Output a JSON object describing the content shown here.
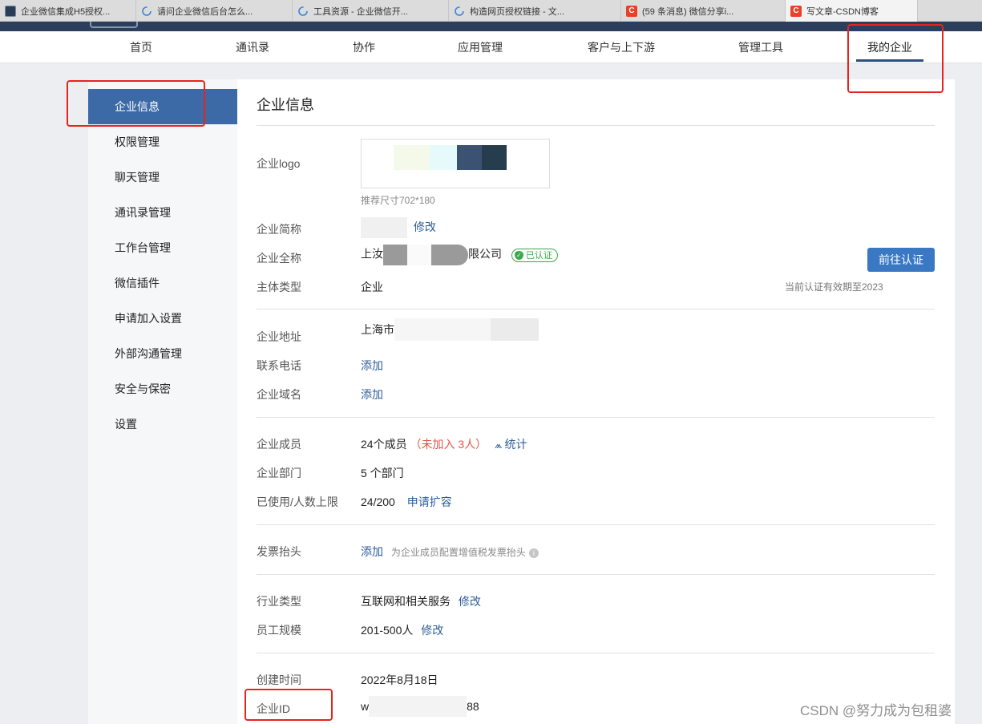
{
  "browser_tabs": [
    {
      "title": "企业微信集成H5授权..."
    },
    {
      "title": "请问企业微信后台怎么..."
    },
    {
      "title": "工具资源 - 企业微信开..."
    },
    {
      "title": "构造网页授权链接 - 文..."
    },
    {
      "title": "(59 条消息) 微信分享i..."
    },
    {
      "title": "写文章-CSDN博客"
    }
  ],
  "topnav": {
    "items": [
      "首页",
      "通讯录",
      "协作",
      "应用管理",
      "客户与上下游",
      "管理工具",
      "我的企业"
    ],
    "active": "我的企业"
  },
  "sidebar": {
    "items": [
      "企业信息",
      "权限管理",
      "聊天管理",
      "通讯录管理",
      "工作台管理",
      "微信插件",
      "申请加入设置",
      "外部沟通管理",
      "安全与保密",
      "设置"
    ],
    "active": "企业信息"
  },
  "main": {
    "title": "企业信息",
    "logo": {
      "label": "企业logo",
      "hint": "推荐尺寸702*180"
    },
    "short_name": {
      "label": "企业简称",
      "action": "修改"
    },
    "full_name": {
      "label": "企业全称",
      "value_start": "上汝",
      "value_end": "限公司",
      "badge": "已认证"
    },
    "entity_type": {
      "label": "主体类型",
      "value": "企业"
    },
    "verify_button": "前往认证",
    "validity_text": "当前认证有效期至2023",
    "address": {
      "label": "企业地址",
      "value": "上海市"
    },
    "phone": {
      "label": "联系电话",
      "action": "添加"
    },
    "domain": {
      "label": "企业域名",
      "action": "添加"
    },
    "members": {
      "label": "企业成员",
      "value": "24个成员",
      "pending": "（未加入 3人）",
      "stats": "统计"
    },
    "departments": {
      "label": "企业部门",
      "value": "5 个部门"
    },
    "capacity": {
      "label": "已使用/人数上限",
      "value": "24/200",
      "action": "申请扩容"
    },
    "invoice": {
      "label": "发票抬头",
      "action": "添加",
      "desc": "为企业成员配置增值税发票抬头"
    },
    "industry": {
      "label": "行业类型",
      "value": "互联网和相关服务",
      "action": "修改"
    },
    "scale": {
      "label": "员工规模",
      "value": "201-500人",
      "action": "修改"
    },
    "created": {
      "label": "创建时间",
      "value": "2022年8月18日"
    },
    "corp_id": {
      "label": "企业ID",
      "value_start": "w",
      "value_end": "88"
    }
  },
  "watermark": "CSDN @努力成为包租婆",
  "colors": {
    "brand": "#3b6aa7",
    "link": "#2d5d98",
    "annotation": "#e8231f",
    "verified": "#3ca84b"
  }
}
